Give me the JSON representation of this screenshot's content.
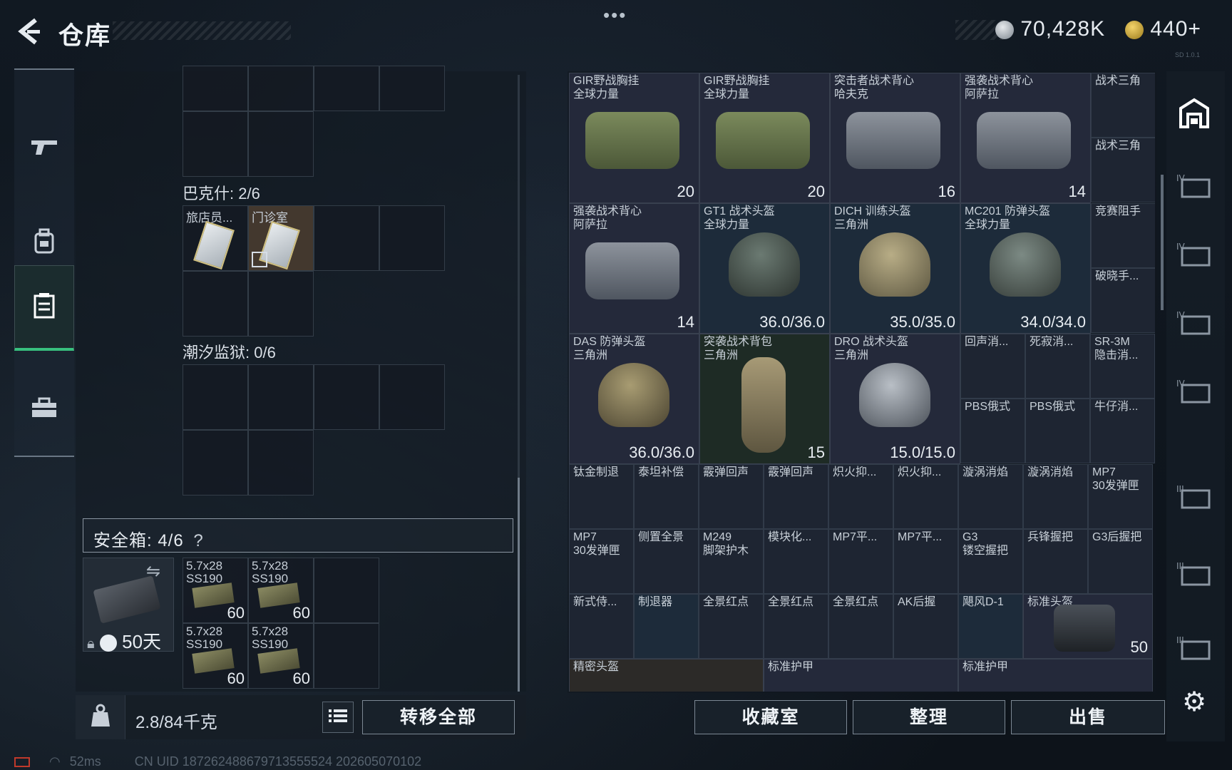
{
  "header": {
    "title": "仓库",
    "currency1": "70,428K",
    "currency2": "440+",
    "version": "SD 1.0.1"
  },
  "nav": [
    "gun-icon",
    "backpack-icon",
    "storage-icon",
    "toolbox-icon"
  ],
  "storage": {
    "section_bakeshi": "巴克什: 2/6",
    "item1_name": "旅店员...",
    "item2_name": "门诊室",
    "section_chaoxi": "潮汐监狱: 0/6"
  },
  "safebox": {
    "label": "安全箱: 4/6",
    "help": "?",
    "timer": "50天",
    "ammo": [
      {
        "name": "5.7x28\nSS190",
        "qty": "60"
      },
      {
        "name": "5.7x28\nSS190",
        "qty": "60"
      },
      {
        "name": "5.7x28\nSS190",
        "qty": "60"
      },
      {
        "name": "5.7x28\nSS190",
        "qty": "60"
      }
    ]
  },
  "bottom": {
    "weight": "2.8/84千克",
    "transfer": "转移全部",
    "collection": "收藏室",
    "sort": "整理",
    "sell": "出售"
  },
  "status": {
    "ping": "52ms",
    "uid": "CN UID 18726248867971355552​4  202605070102"
  },
  "warehouse": {
    "big": [
      {
        "name": "GIR野战胸挂\n全球力量",
        "qty": "20"
      },
      {
        "name": "GIR野战胸挂\n全球力量",
        "qty": "20"
      },
      {
        "name": "突击者战术背心\n哈夫克",
        "qty": "16"
      },
      {
        "name": "强袭战术背心\n阿萨拉",
        "qty": "14"
      },
      {
        "name": "强袭战术背心\n阿萨拉",
        "qty": "14"
      },
      {
        "name": "GT1 战术头盔\n全球力量",
        "qty": "36.0/36.0"
      },
      {
        "name": "DICH 训练头盔\n三角洲",
        "qty": "35.0/35.0"
      },
      {
        "name": "MC201 防弹头盔\n全球力量",
        "qty": "34.0/34.0"
      },
      {
        "name": "DAS 防弹头盔\n三角洲",
        "qty": "36.0/36.0"
      },
      {
        "name": "突袭战术背包\n三角洲",
        "qty": "15"
      },
      {
        "name": "DRO 战术头盔\n三角洲",
        "qty": "15.0/15.0"
      }
    ],
    "small": [
      {
        "name": "战术三角"
      },
      {
        "name": "战术三角"
      },
      {
        "name": "竞赛阻手"
      },
      {
        "name": "破晓手..."
      },
      {
        "name": "回声消..."
      },
      {
        "name": "死寂消..."
      },
      {
        "name": "SR-3M\n隐击消..."
      },
      {
        "name": "PBS俄式"
      },
      {
        "name": "PBS俄式"
      },
      {
        "name": "牛仔消..."
      },
      {
        "name": "钛金制退"
      },
      {
        "name": "泰坦补偿"
      },
      {
        "name": "霰弹回声"
      },
      {
        "name": "霰弹回声"
      },
      {
        "name": "炽火抑..."
      },
      {
        "name": "炽火抑..."
      },
      {
        "name": "漩涡消焰"
      },
      {
        "name": "漩涡消焰"
      },
      {
        "name": "MP7\n30发弹匣"
      },
      {
        "name": "MP7\n30发弹匣"
      },
      {
        "name": "侧置全景"
      },
      {
        "name": "M249\n脚架护木"
      },
      {
        "name": "模块化..."
      },
      {
        "name": "MP7平..."
      },
      {
        "name": "MP7平..."
      },
      {
        "name": "G3\n镂空握把"
      },
      {
        "name": "兵锋握把"
      },
      {
        "name": "G3后握把"
      },
      {
        "name": "新式侍..."
      },
      {
        "name": "制退器"
      },
      {
        "name": "全景红点"
      },
      {
        "name": "全景红点"
      },
      {
        "name": "全景红点"
      },
      {
        "name": "AK后握"
      },
      {
        "name": "飓风D-1"
      }
    ],
    "helmet_std": {
      "name": "标准头盔",
      "qty": "50"
    },
    "bottom_row": [
      "精密头盔",
      "标准护甲",
      "标准护甲"
    ]
  },
  "colors": {
    "accent": "#38c07e",
    "bg": "#0f151d"
  }
}
